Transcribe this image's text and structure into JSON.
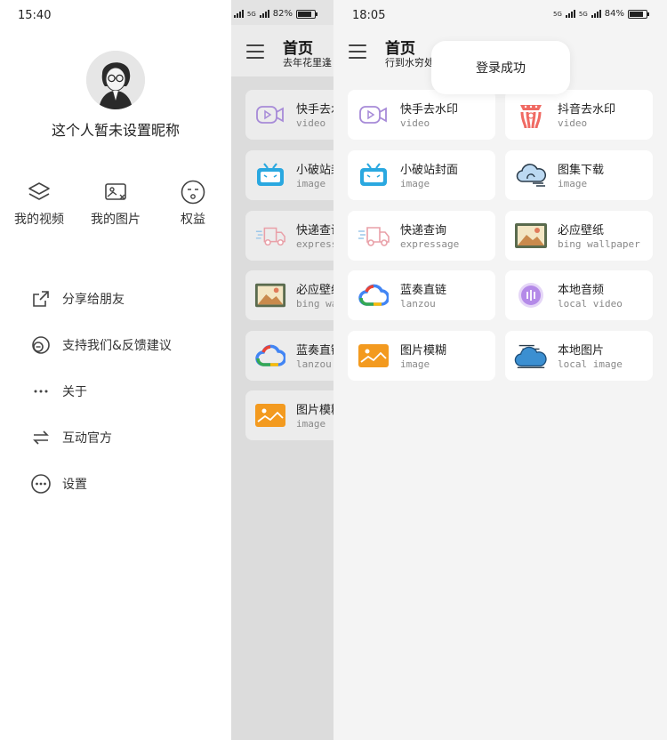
{
  "drawer": {
    "time": "15:40",
    "nickname": "这个人暂未设置昵称",
    "quick_actions": [
      {
        "label": "我的视频",
        "icon": "layers-icon"
      },
      {
        "label": "我的图片",
        "icon": "image-frame-icon"
      },
      {
        "label": "权益",
        "icon": "emoji-face-icon"
      }
    ],
    "menu": [
      {
        "label": "分享给朋友",
        "icon": "share-icon"
      },
      {
        "label": "支持我们&反馈建议",
        "icon": "feedback-icon"
      },
      {
        "label": "关于",
        "icon": "more-dots-icon"
      },
      {
        "label": "互动官方",
        "icon": "swap-arrows-icon"
      },
      {
        "label": "设置",
        "icon": "settings-circle-icon"
      }
    ]
  },
  "middle": {
    "status": {
      "signal": "5G",
      "battery": "82%"
    },
    "title": "首页",
    "subtitle": "去年花里逢",
    "cards": [
      {
        "title": "快手去水",
        "sub": "video"
      },
      {
        "title": "小破站封",
        "sub": "image"
      },
      {
        "title": "快递查询",
        "sub": "expressage"
      },
      {
        "title": "必应壁纸",
        "sub": "bing wallpaper"
      },
      {
        "title": "蓝奏直链",
        "sub": "lanzou"
      },
      {
        "title": "图片模糊",
        "sub": "image"
      }
    ]
  },
  "main": {
    "status": {
      "time": "18:05",
      "signal": "5G",
      "battery": "84%"
    },
    "title": "首页",
    "subtitle": "行到水穷处",
    "toast": "登录成功",
    "cards": [
      {
        "title": "快手去水印",
        "sub": "video",
        "icon": "kuaishou-video-icon"
      },
      {
        "title": "抖音去水印",
        "sub": "video",
        "icon": "douyin-icon"
      },
      {
        "title": "小破站封面",
        "sub": "image",
        "icon": "bilibili-tv-icon"
      },
      {
        "title": "图集下载",
        "sub": "image",
        "icon": "cloud-download-icon"
      },
      {
        "title": "快递查询",
        "sub": "expressage",
        "icon": "delivery-truck-icon"
      },
      {
        "title": "必应壁纸",
        "sub": "bing wallpaper",
        "icon": "landscape-picture-icon"
      },
      {
        "title": "蓝奏直链",
        "sub": "lanzou",
        "icon": "cloud-link-icon"
      },
      {
        "title": "本地音频",
        "sub": "local video",
        "icon": "audio-disc-icon"
      },
      {
        "title": "图片模糊",
        "sub": "image",
        "icon": "blur-image-icon"
      },
      {
        "title": "本地图片",
        "sub": "local image",
        "icon": "weather-cloud-icon"
      }
    ]
  },
  "colors": {
    "kuaishou": "#a78bd8",
    "douyin": "#f06a63",
    "bilibili": "#2aa8e0",
    "truck": "#e9a0a8",
    "wallpaper_frame": "#5a6b4e",
    "lanzou_blue": "#4285f4",
    "audio_purple": "#b48ae8",
    "blur_orange": "#f39a1f",
    "cloud_blue": "#3b8fd1"
  }
}
